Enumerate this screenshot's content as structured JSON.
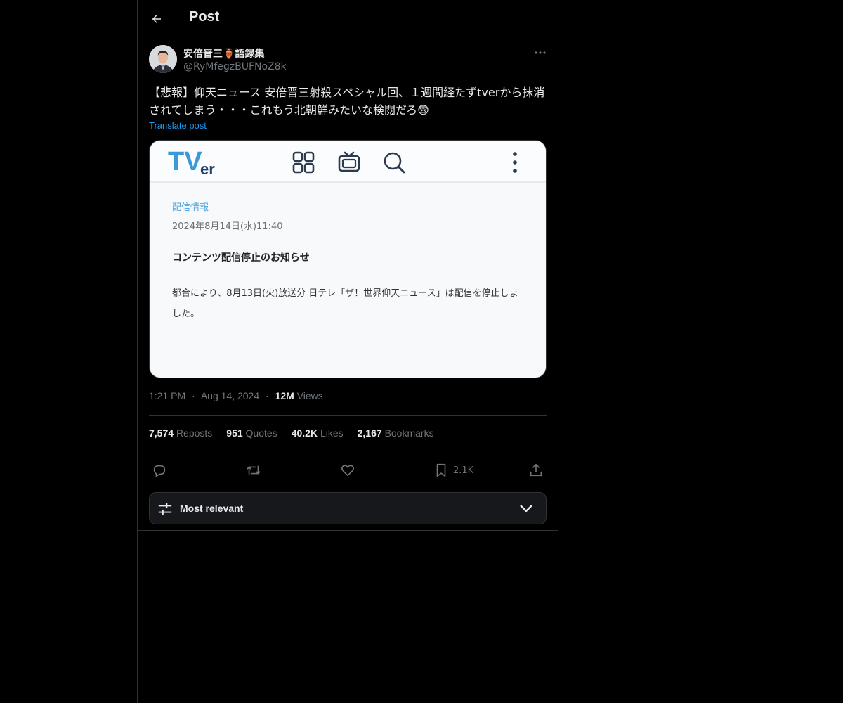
{
  "header": {
    "title": "Post"
  },
  "author": {
    "display_name": "安倍晋三🏺語録集",
    "handle": "@RyMfegzBUFNoZ8k"
  },
  "tweet": {
    "text": "【悲報】仰天ニュース 安倍晋三射殺スペシャル回、１週間経たずtverから抹消されてしまう・・・これもう北朝鮮みたいな検閲だろ😨",
    "translate_label": "Translate post"
  },
  "media": {
    "logo_text": "TVer",
    "category": "配信情報",
    "date": "2024年8月14日(水)11:40",
    "title": "コンテンツ配信停止のお知らせ",
    "body": "都合により、8月13日(火)放送分 日テレ「ザ！世界仰天ニュース」は配信を停止しました。"
  },
  "meta": {
    "time": "1:21 PM",
    "separator": "·",
    "date": "Aug 14, 2024",
    "views_count": "12M",
    "views_label": "Views"
  },
  "stats": [
    {
      "num": "7,574",
      "label": "Reposts"
    },
    {
      "num": "951",
      "label": "Quotes"
    },
    {
      "num": "40.2K",
      "label": "Likes"
    },
    {
      "num": "2,167",
      "label": "Bookmarks"
    }
  ],
  "actions": {
    "bookmark_count": "2.1K"
  },
  "sort": {
    "label": "Most relevant"
  },
  "colors": {
    "background": "#000000",
    "text_primary": "#e7e9ea",
    "text_secondary": "#71767b",
    "link": "#1d9bf0",
    "border": "#2f3336",
    "tver_blue": "#4aa3df"
  }
}
